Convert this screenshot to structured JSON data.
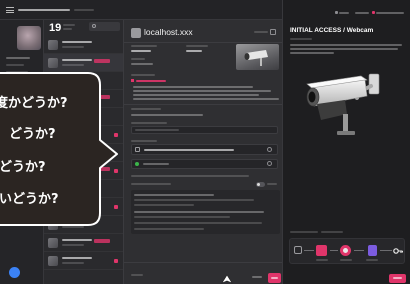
{
  "list": {
    "count": "19"
  },
  "main": {
    "host_title": "localhost.xxx"
  },
  "detail": {
    "title": "INITIAL ACCESS / Webcam"
  },
  "bubble": {
    "lines": [
      "度かどうか?",
      "どうか?",
      "どうか?",
      "いどうか?"
    ]
  },
  "icons": [
    "menu-icon",
    "search-icon",
    "link-icon",
    "webcam-illustration",
    "toggle-switch",
    "attack-chain-node-icon",
    "mouse-cursor-icon"
  ],
  "colors": {
    "accent": "#e0356a",
    "ok": "#3bb54a",
    "nav": "#3b82f6",
    "purple": "#7c5ce0"
  }
}
